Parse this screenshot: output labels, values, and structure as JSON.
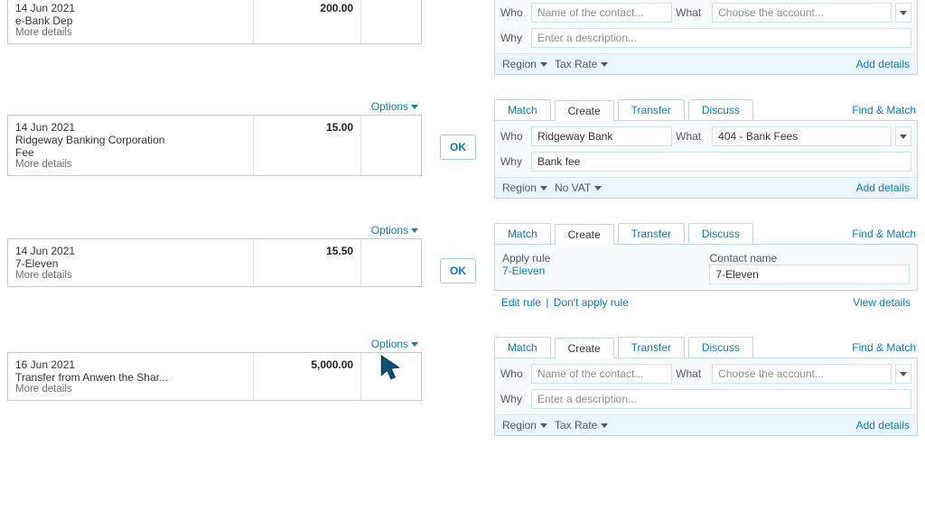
{
  "labels": {
    "options": "Options",
    "more_details": "More details",
    "ok": "OK",
    "who": "Who",
    "what": "What",
    "why": "Why",
    "region": "Region",
    "tax_rate": "Tax Rate",
    "add_details": "Add details",
    "find_match": "Find & Match",
    "contact_placeholder": "Name of the contact...",
    "account_placeholder": "Choose the account...",
    "desc_placeholder": "Enter a description...",
    "apply_rule": "Apply rule",
    "contact_name": "Contact name",
    "edit_rule": "Edit rule",
    "dont_apply": "Don't apply rule",
    "view_details": "View details"
  },
  "tabs": [
    "Match",
    "Create",
    "Transfer",
    "Discuss"
  ],
  "rows": [
    {
      "date": "14 Jun 2021",
      "line1": "e-Bank Dep",
      "line2": "",
      "amount": "200.00",
      "ok": false,
      "panel": {
        "type": "create",
        "who": "",
        "what": "",
        "why": "",
        "region": "",
        "tax": "Tax Rate"
      }
    },
    {
      "date": "14 Jun 2021",
      "line1": "Ridgeway Banking Corporation",
      "line2": "Fee",
      "amount": "15.00",
      "ok": true,
      "panel": {
        "type": "create",
        "who": "Ridgeway Bank",
        "what": "404 - Bank Fees",
        "why": "Bank fee",
        "region": "",
        "tax": "No VAT"
      }
    },
    {
      "date": "14 Jun 2021",
      "line1": "7-Eleven",
      "line2": "",
      "amount": "15.50",
      "ok": true,
      "panel": {
        "type": "rule",
        "rule_name": "7-Eleven",
        "contact": "7-Eleven"
      }
    },
    {
      "date": "16 Jun 2021",
      "line1": "Transfer from Anwen the Shar...",
      "line2": "",
      "amount": "5,000.00",
      "ok": false,
      "panel": {
        "type": "create",
        "who": "",
        "what": "",
        "why": "",
        "region": "",
        "tax": "Tax Rate"
      }
    }
  ]
}
